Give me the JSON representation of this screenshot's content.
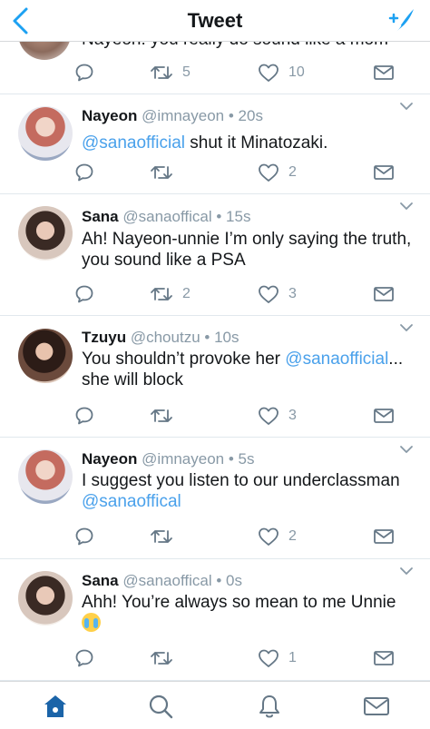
{
  "nav": {
    "title": "Tweet"
  },
  "partial_tweet": {
    "text": "Nayeon: you really do sound like a mom",
    "retweets": "5",
    "likes": "10"
  },
  "tweets": [
    {
      "name": "Nayeon",
      "handle": "@imnayeon",
      "time": "20s",
      "mention": "@sanaofficial",
      "text_after": " shut it Minatozaki.",
      "retweets": "",
      "likes": "2"
    },
    {
      "name": "Sana",
      "handle": "@sanaoffical",
      "time": "15s",
      "text": "Ah! Nayeon-unnie I’m only saying the truth, you sound like a PSA",
      "retweets": "2",
      "likes": "3"
    },
    {
      "name": "Tzuyu",
      "handle": "@choutzu",
      "time": "10s",
      "text_before": "You shouldn’t provoke her ",
      "mention": "@sanaofficial",
      "text_after": "... she will block",
      "retweets": "",
      "likes": "3"
    },
    {
      "name": "Nayeon",
      "handle": "@imnayeon",
      "time": "5s",
      "text_before": "I suggest you listen to our underclassman ",
      "mention": "@sanaoffical",
      "retweets": "",
      "likes": "2"
    },
    {
      "name": "Sana",
      "handle": "@sanaoffical",
      "time": "0s",
      "text": "Ahh! You’re always so mean to me Unnie ",
      "retweets": "",
      "likes": "1"
    }
  ],
  "separator": "•",
  "icons": {
    "back": "chevron-left-icon",
    "compose": "compose-feather-icon",
    "reply": "reply-icon",
    "retweet": "retweet-icon",
    "like": "heart-icon",
    "dm": "envelope-icon",
    "home": "home-icon",
    "search": "search-icon",
    "notifications": "bell-icon",
    "messages": "envelope-icon"
  },
  "colors": {
    "accent": "#1da1f2",
    "mention": "#4aa1eb",
    "muted": "#8899a6",
    "tab_active": "#1b64a8"
  }
}
